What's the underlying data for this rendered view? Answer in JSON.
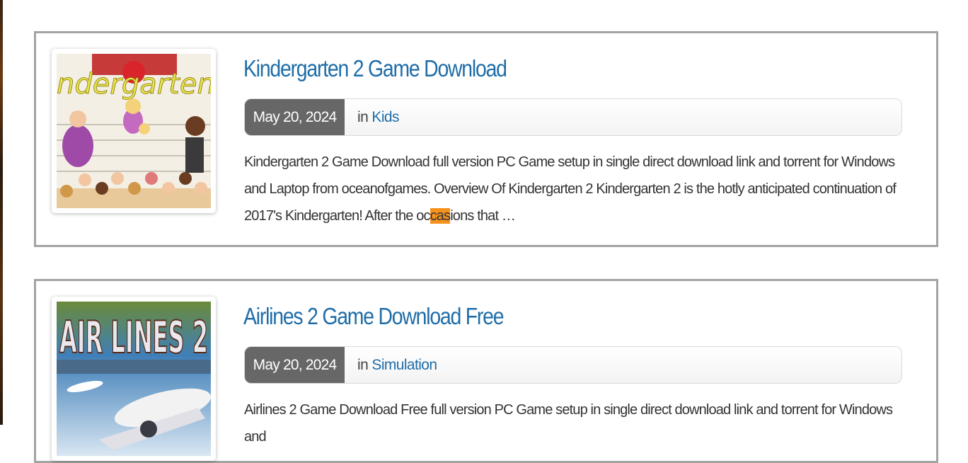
{
  "posts": [
    {
      "title": "Kindergarten 2 Game Download",
      "date": "May 20, 2024",
      "in_label": "in",
      "category": "Kids",
      "excerpt_before": "Kindergarten 2 Game Download full version PC Game setup in single direct download link and torrent for Windows and Laptop from oceanofgames. Overview Of Kindergarten 2 Kindergarten 2 is the hotly anticipated continuation of 2017's Kindergarten! After the oc",
      "excerpt_highlight": "cas",
      "excerpt_after": "ions that …",
      "thumb_text": "ndergarten"
    },
    {
      "title": "Airlines 2 Game Download Free",
      "date": "May 20, 2024",
      "in_label": "in",
      "category": "Simulation",
      "excerpt_before": "Airlines 2 Game Download Free full version PC Game setup in single direct download link and torrent for Windows and",
      "excerpt_highlight": "",
      "excerpt_after": "",
      "thumb_text": "AIR LINES 2"
    }
  ],
  "colors": {
    "link": "#1f6da8",
    "date_badge": "#676767",
    "card_border": "#a3a3a3",
    "highlight": "#f5921e"
  }
}
